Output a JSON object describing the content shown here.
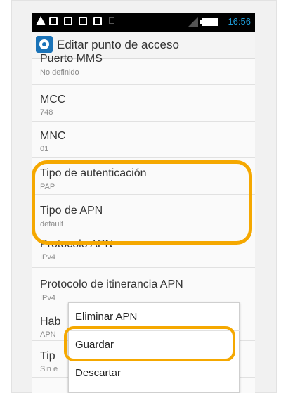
{
  "statusbar": {
    "time": "16:56",
    "icons": [
      "warning-icon",
      "image-icon",
      "mail-icon",
      "bag-icon",
      "bag-icon",
      "sim-icon",
      "signal-icon",
      "battery-icon"
    ]
  },
  "actionbar": {
    "icon": "settings-icon",
    "title": "Editar punto de acceso"
  },
  "list": {
    "items": [
      {
        "title": "Puerto MMS",
        "summary": "No definido"
      },
      {
        "title": "MCC",
        "summary": "748"
      },
      {
        "title": "MNC",
        "summary": "01"
      },
      {
        "title": "Tipo de autenticación",
        "summary": "PAP"
      },
      {
        "title": "Tipo de APN",
        "summary": "default"
      },
      {
        "title": "Protocolo APN",
        "summary": "IPv4"
      },
      {
        "title": "Protocolo de itinerancia APN",
        "summary": "IPv4"
      },
      {
        "title": "Hab",
        "summary": "APN"
      },
      {
        "title": "Tip",
        "summary": "Sin e"
      }
    ]
  },
  "menu": {
    "items": [
      "Eliminar APN",
      "Guardar",
      "Descartar"
    ]
  },
  "colors": {
    "highlight": "#f5a800",
    "accent": "#1e9bd7"
  }
}
